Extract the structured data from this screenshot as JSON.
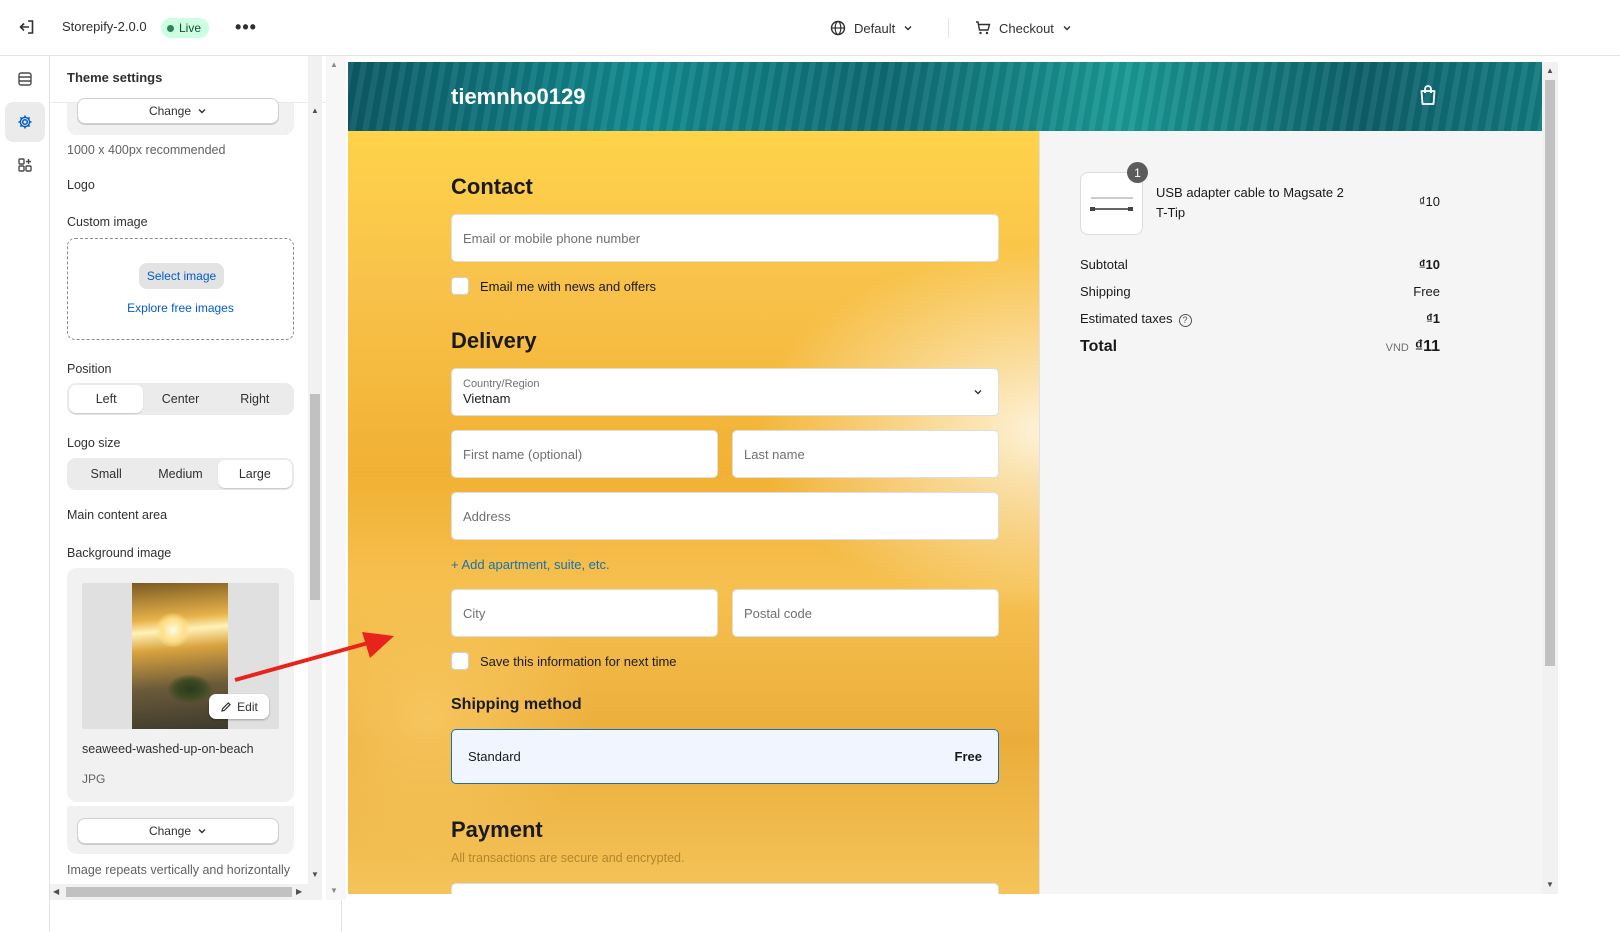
{
  "topbar": {
    "app_title": "Storepify-2.0.0",
    "status_badge": "Live",
    "more_label": "•••",
    "view_select": "Default",
    "page_select": "Checkout"
  },
  "panel": {
    "title": "Theme settings",
    "change_label": "Change",
    "recommended": "1000 x 400px recommended",
    "logo_heading": "Logo",
    "custom_image_label": "Custom image",
    "select_image": "Select image",
    "explore_images": "Explore free images",
    "position_label": "Position",
    "position_options": [
      "Left",
      "Center",
      "Right"
    ],
    "logo_size_label": "Logo size",
    "logo_size_options": [
      "Small",
      "Medium",
      "Large"
    ],
    "main_content_heading": "Main content area",
    "bg_image_label": "Background image",
    "edit_label": "Edit",
    "file_name": "seaweed-washed-up-on-beach",
    "file_type": "JPG",
    "change_label_2": "Change",
    "repeat_note": "Image repeats vertically and horizontally"
  },
  "preview": {
    "store_name": "tiemnho0129",
    "contact_heading": "Contact",
    "email_placeholder": "Email or mobile phone number",
    "email_news": "Email me with news and offers",
    "delivery_heading": "Delivery",
    "country_label": "Country/Region",
    "country_value": "Vietnam",
    "first_name": "First name (optional)",
    "last_name": "Last name",
    "address": "Address",
    "add_apartment": "+ Add apartment, suite, etc.",
    "city": "City",
    "postal_code": "Postal code",
    "save_info": "Save this information for next time",
    "shipping_method_heading": "Shipping method",
    "shipping_option": "Standard",
    "shipping_price": "Free",
    "payment_heading": "Payment",
    "payment_note": "All transactions are secure and encrypted."
  },
  "summary": {
    "qty": "1",
    "product_name": "USB adapter cable to Magsate 2 T-Tip",
    "product_price": "₫10",
    "subtotal_label": "Subtotal",
    "subtotal_value": "₫10",
    "shipping_label": "Shipping",
    "shipping_value": "Free",
    "taxes_label": "Estimated taxes",
    "taxes_value": "₫1",
    "total_label": "Total",
    "currency": "VND",
    "total_value": "₫11"
  },
  "colors": {
    "accent": "#005bd3",
    "link": "#1773b0",
    "live_bg": "#cdfee1",
    "annotation_arrow": "#e8231c"
  },
  "icons": [
    "exit-icon",
    "more-icon",
    "globe-icon",
    "cart-icon",
    "chevron-down-icon",
    "sections-icon",
    "gear-icon",
    "apps-icon",
    "pencil-icon",
    "bag-icon",
    "help-icon"
  ]
}
